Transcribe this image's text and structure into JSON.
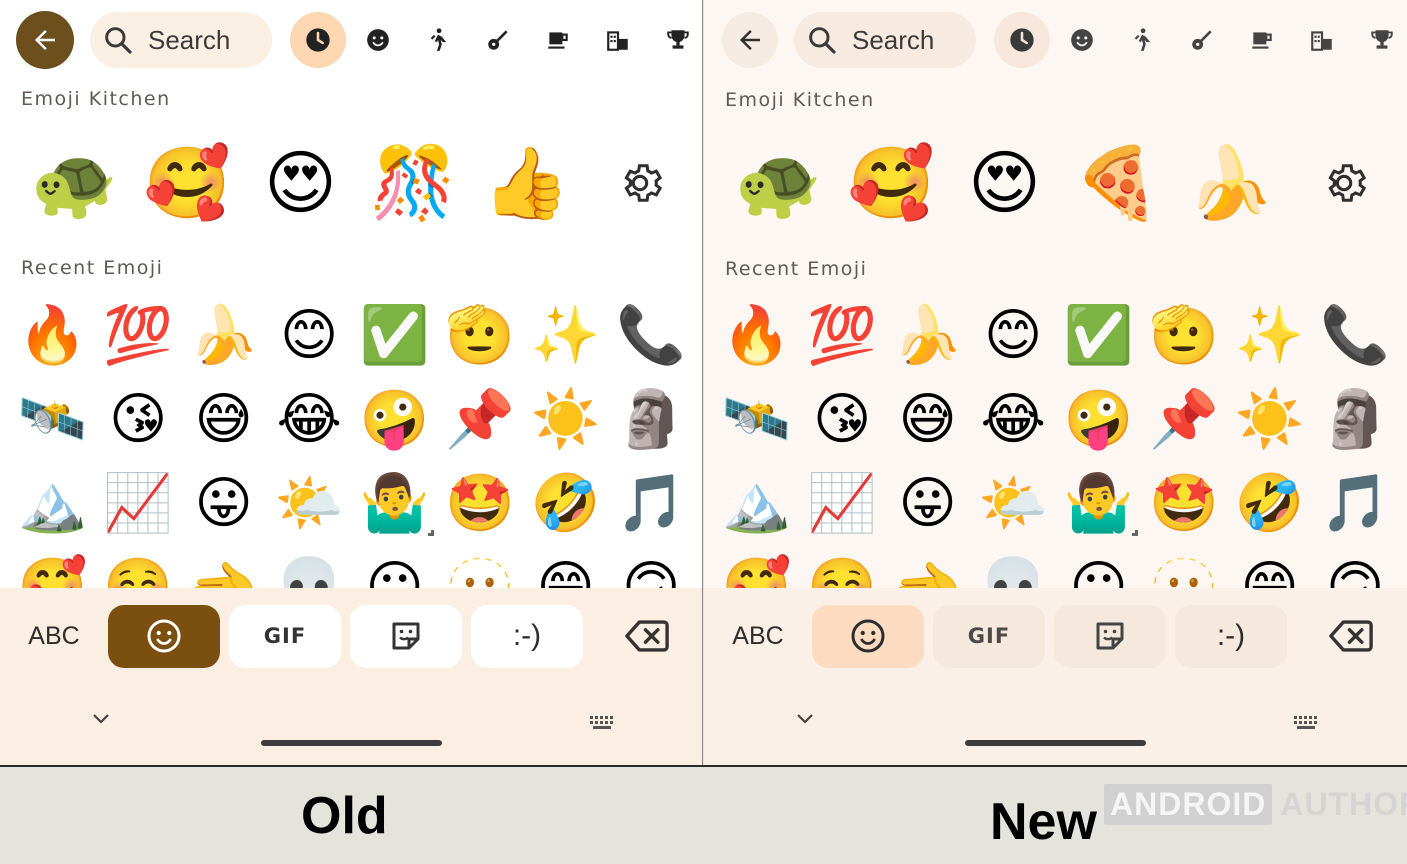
{
  "panels": [
    {
      "id": "old",
      "search": {
        "label": "Search"
      },
      "categories": [
        "recent",
        "smileys",
        "people",
        "animals",
        "food",
        "travel",
        "activities"
      ],
      "kitchen_title": "Emoji Kitchen",
      "kitchen_emojis": [
        "🐢",
        "🥰",
        "😍",
        "🎊",
        "👍"
      ],
      "recent_title": "Recent Emoji",
      "recent_emojis": [
        "🔥",
        "💯",
        "🍌",
        "😊",
        "✅",
        "🫡",
        "✨",
        "📞",
        "🛰️",
        "😘",
        "😅",
        "😂",
        "🤪",
        "📌",
        "☀️",
        "🗿",
        "🏔️",
        "📈",
        "😛",
        "🌤️",
        "🤷‍♂️",
        "🤩",
        "🤣",
        "🎵",
        "🥰",
        "☺️",
        "🫲",
        "💀",
        "😶",
        "🫥",
        "😁",
        "🙃"
      ],
      "modes": {
        "abc": "ABC",
        "gif": "GIF",
        "emoticon": ":-)"
      },
      "caption": "Old"
    },
    {
      "id": "new",
      "search": {
        "label": "Search"
      },
      "categories": [
        "recent",
        "smileys",
        "people",
        "animals",
        "food",
        "travel",
        "activities"
      ],
      "kitchen_title": "Emoji Kitchen",
      "kitchen_emojis": [
        "🐢",
        "🥰",
        "😍",
        "🍕",
        "🍌"
      ],
      "recent_title": "Recent Emoji",
      "recent_emojis": [
        "🔥",
        "💯",
        "🍌",
        "😊",
        "✅",
        "🫡",
        "✨",
        "📞",
        "🛰️",
        "😘",
        "😅",
        "😂",
        "🤪",
        "📌",
        "☀️",
        "🗿",
        "🏔️",
        "📈",
        "😛",
        "🌤️",
        "🤷‍♂️",
        "🤩",
        "🤣",
        "🎵",
        "🥰",
        "☺️",
        "🫲",
        "💀",
        "😶",
        "🫥",
        "😁",
        "🙃"
      ],
      "modes": {
        "abc": "ABC",
        "gif": "GIF",
        "emoticon": ":-)"
      },
      "caption": "New"
    }
  ],
  "watermark": {
    "part1": "ANDROID",
    "part2": "AUTHORITY"
  },
  "colors": {
    "old_accent": "#6b4f1d",
    "old_active_tab": "#fcd7b1",
    "new_active_tab": "#fcdcc0"
  }
}
